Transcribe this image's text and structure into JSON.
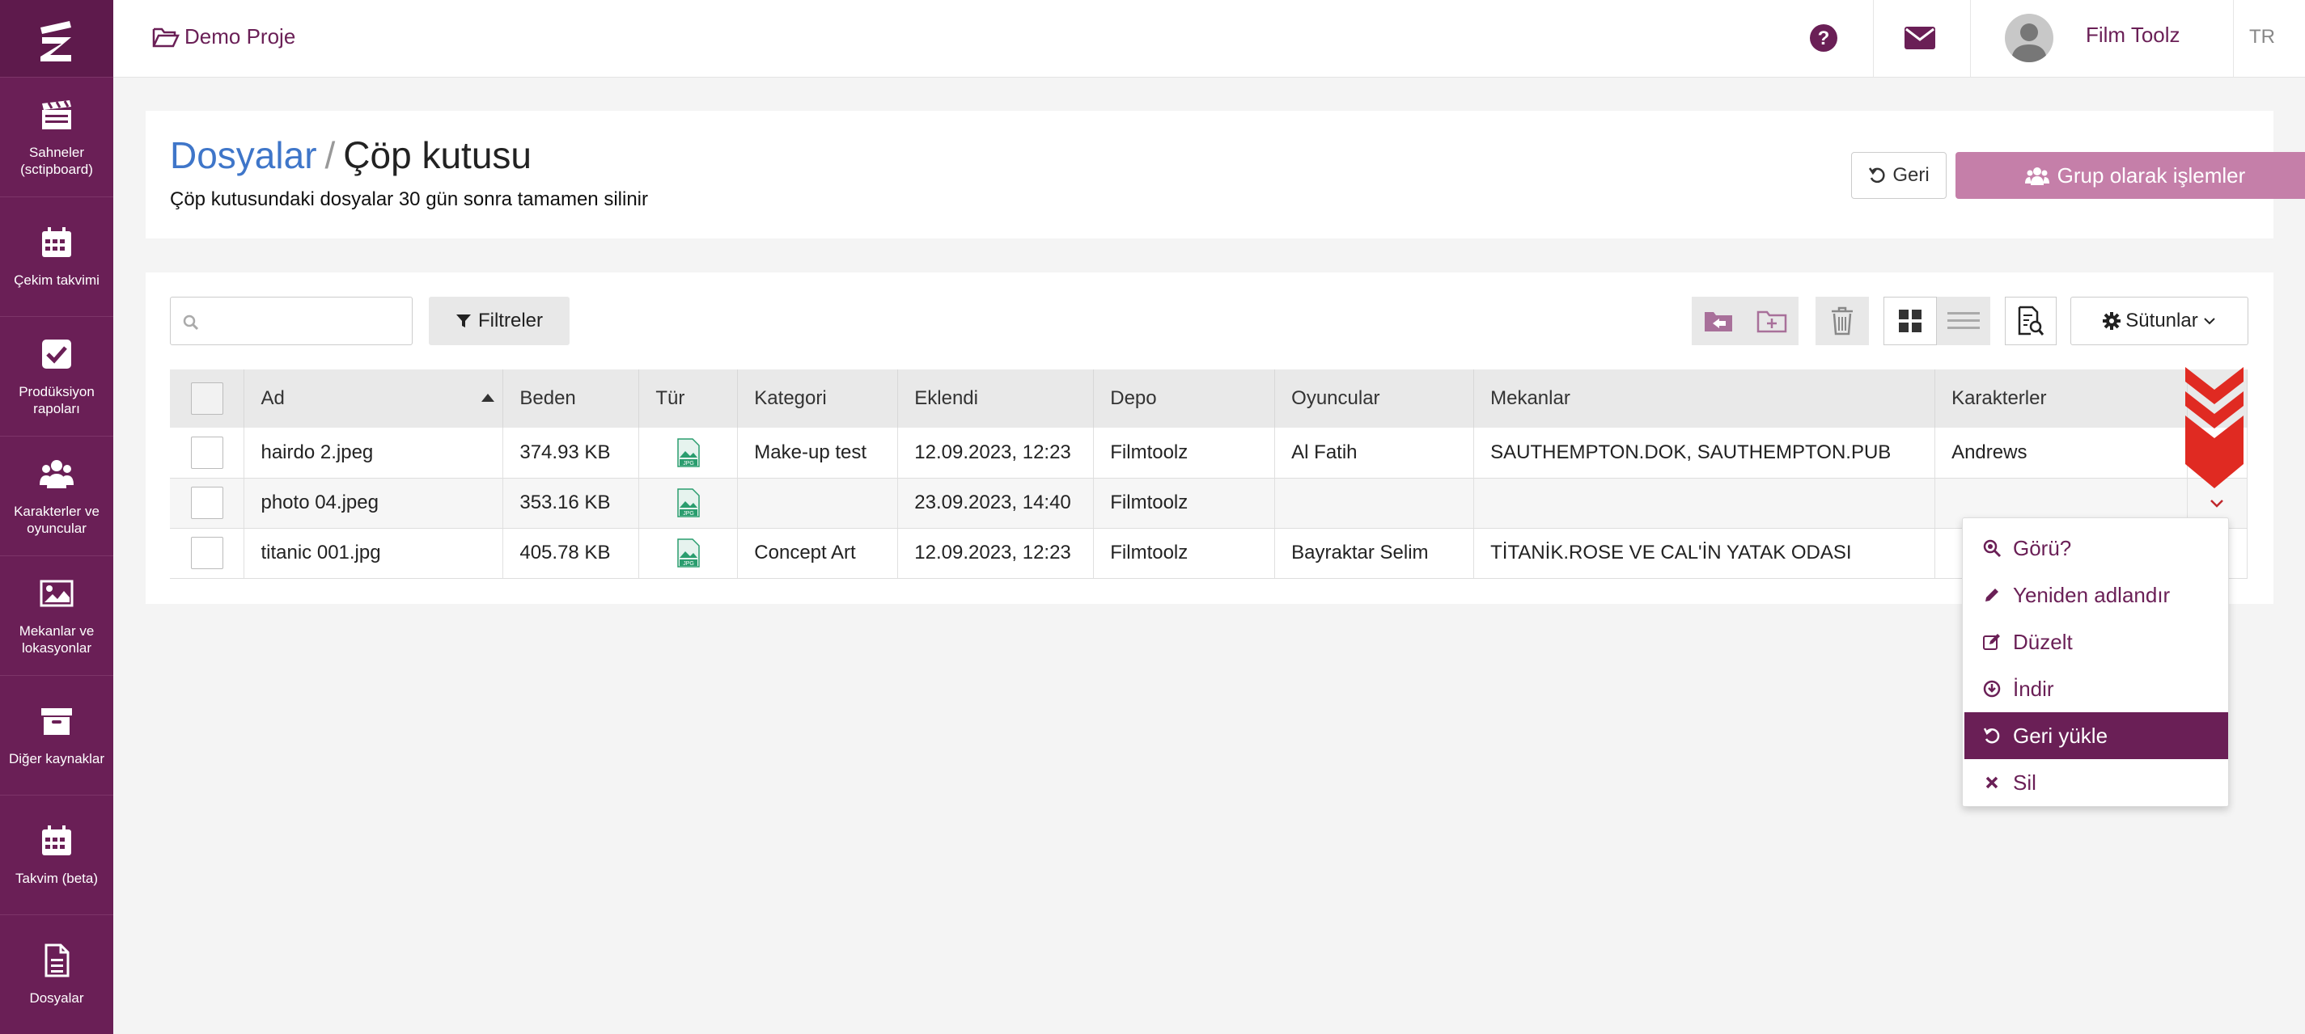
{
  "sidebar": {
    "items": [
      {
        "label": "Sahneler (sctipboard)",
        "icon": "clapperboard-icon"
      },
      {
        "label": "Çekim takvimi",
        "icon": "calendar-icon"
      },
      {
        "label": "Prodüksiyon rapoları",
        "icon": "checkbox-icon"
      },
      {
        "label": "Karakterler ve oyuncular",
        "icon": "users-icon"
      },
      {
        "label": "Mekanlar ve lokasyonlar",
        "icon": "image-icon"
      },
      {
        "label": "Diğer kaynaklar",
        "icon": "archive-icon"
      },
      {
        "label": "Takvim (beta)",
        "icon": "calendar-icon"
      },
      {
        "label": "Dosyalar",
        "icon": "file-icon"
      }
    ]
  },
  "topbar": {
    "project": "Demo Proje",
    "user": "Film Toolz",
    "lang": "TR"
  },
  "header": {
    "crumb_link": "Dosyalar",
    "crumb_sep": "/",
    "crumb_current": "Çöp kutusu",
    "subtitle": "Çöp kutusundaki dosyalar 30 gün sonra tamamen silinir",
    "back_label": "Geri",
    "group_label": "Grup olarak işlemler"
  },
  "toolbar": {
    "filter_label": "Filtreler",
    "columns_label": "Sütunlar"
  },
  "table": {
    "columns": [
      "Ad",
      "Beden",
      "Tür",
      "Kategori",
      "Eklendi",
      "Depo",
      "Oyuncular",
      "Mekanlar",
      "Karakterler"
    ],
    "rows": [
      {
        "name": "hairdo 2.jpeg",
        "size": "374.93 KB",
        "category": "Make-up test",
        "added": "12.09.2023, 12:23",
        "storage": "Filmtoolz",
        "actors": "Al Fatih",
        "locations": "SAUTHEMPTON.DOK, SAUTHEMPTON.PUB",
        "characters": "Andrews"
      },
      {
        "name": "photo 04.jpeg",
        "size": "353.16 KB",
        "category": "",
        "added": "23.09.2023, 14:40",
        "storage": "Filmtoolz",
        "actors": "",
        "locations": "",
        "characters": ""
      },
      {
        "name": "titanic 001.jpg",
        "size": "405.78 KB",
        "category": "Concept Art",
        "added": "12.09.2023, 12:23",
        "storage": "Filmtoolz",
        "actors": "Bayraktar Selim",
        "locations": "TİTANİK.ROSE VE CAL'İN YATAK ODASI",
        "characters": ""
      }
    ]
  },
  "dropdown": {
    "items": [
      "Görü?",
      "Yeniden adlandır",
      "Düzelt",
      "İndir",
      "Geri yükle",
      "Sil"
    ],
    "active": "Geri yükle"
  },
  "colors": {
    "brand": "#6a1f56",
    "link": "#3f76c9",
    "group_button": "#c57fa9"
  }
}
